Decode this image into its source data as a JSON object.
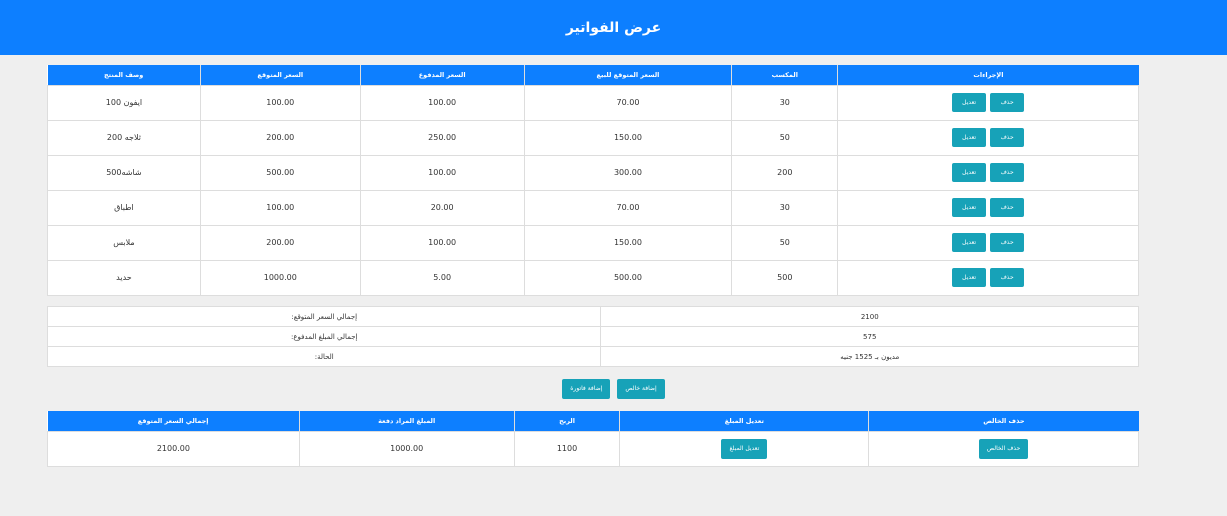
{
  "page": {
    "title": "عرض الفواتير"
  },
  "products": {
    "headers": [
      "وصف المنتج",
      "السعر المتوقع",
      "السعر المدفوع",
      "السعر المتوقع للبيع",
      "المكسب",
      "الإجراءات"
    ],
    "delete_label": "حذف",
    "edit_label": "تعديل",
    "rows": [
      {
        "desc": "ايفون 100",
        "expected": "100.00",
        "paid": "100.00",
        "sale": "70.00",
        "profit": "30"
      },
      {
        "desc": "ثلاجه 200",
        "expected": "200.00",
        "paid": "250.00",
        "sale": "150.00",
        "profit": "50"
      },
      {
        "desc": "شاشه500",
        "expected": "500.00",
        "paid": "100.00",
        "sale": "300.00",
        "profit": "200"
      },
      {
        "desc": "اطباق",
        "expected": "100.00",
        "paid": "20.00",
        "sale": "70.00",
        "profit": "30"
      },
      {
        "desc": "ملابس",
        "expected": "200.00",
        "paid": "100.00",
        "sale": "150.00",
        "profit": "50"
      },
      {
        "desc": "حديد",
        "expected": "1000.00",
        "paid": "5.00",
        "sale": "500.00",
        "profit": "500"
      }
    ]
  },
  "summary": {
    "rows": [
      {
        "label": ":إجمالي السعر المتوقع",
        "value": "2100"
      },
      {
        "label": ":إجمالي المبلغ المدفوع",
        "value": "575"
      },
      {
        "label": ":الحالة",
        "value": "مديون بـ 1525 جنيه"
      }
    ]
  },
  "actions": {
    "add_invoice": "إضافة فاتورة",
    "add_client": "إضافة خالص"
  },
  "payments": {
    "headers": [
      "إجمالي السعر المتوقع",
      "المبلغ المراد دفعة",
      "الربح",
      "تعديل المبلغ",
      "حذف الخالص"
    ],
    "edit_amount_label": "تعديل المبلغ",
    "delete_client_label": "حذف الخالص",
    "rows": [
      {
        "total": "2100.00",
        "amount": "1000.00",
        "profit": "1100"
      }
    ]
  }
}
